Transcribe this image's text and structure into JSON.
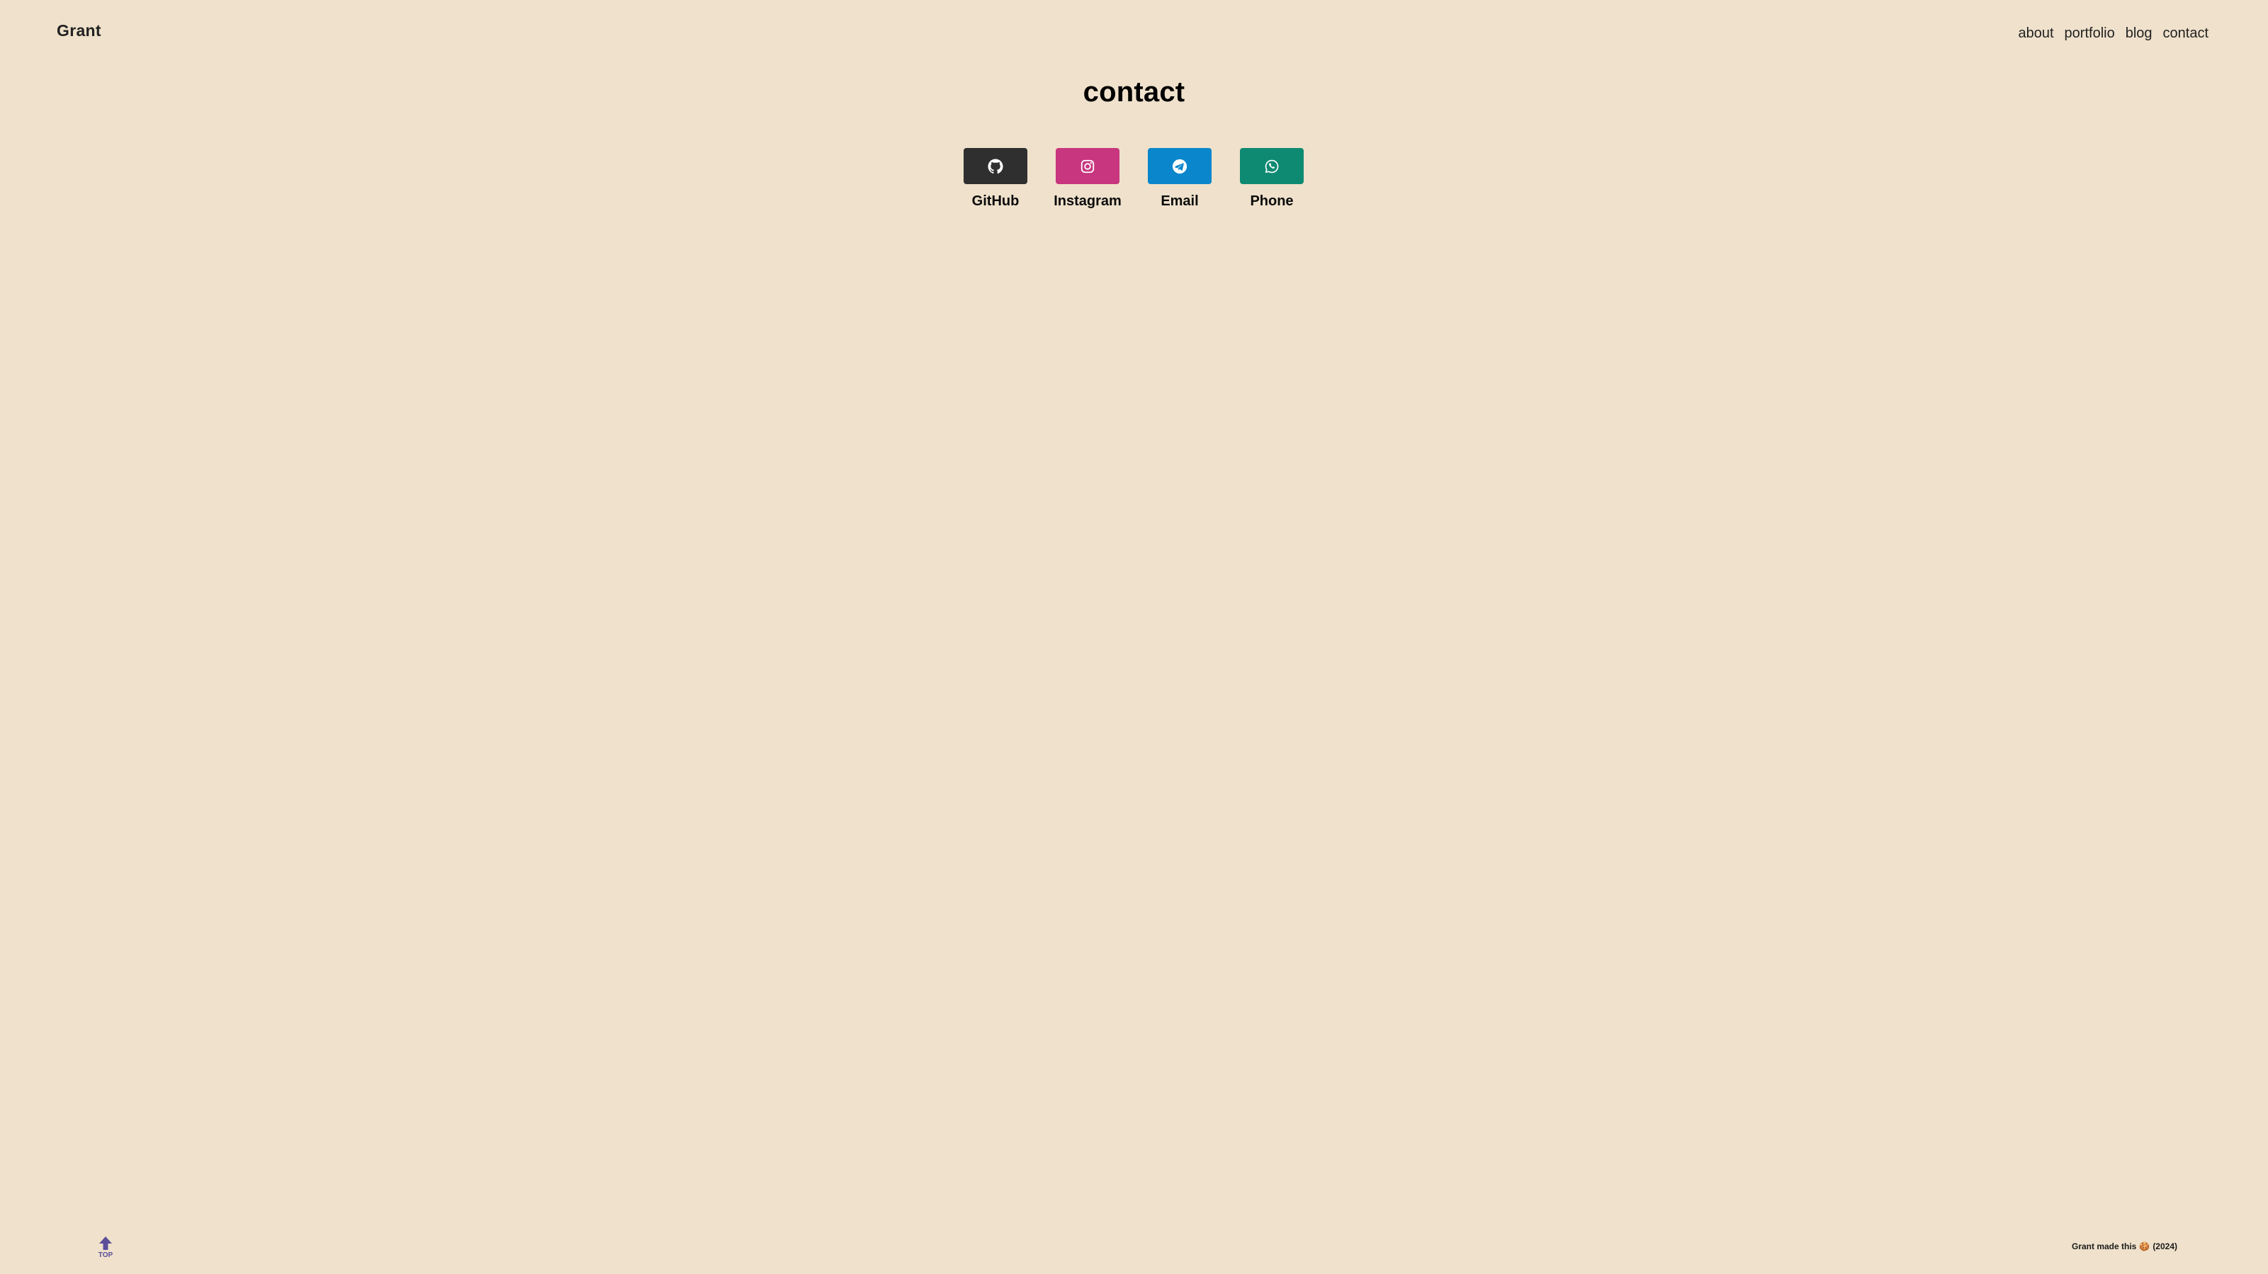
{
  "header": {
    "brand": "Grant",
    "nav": [
      "about",
      "portfolio",
      "blog",
      "contact"
    ]
  },
  "main": {
    "title": "contact",
    "contacts": [
      {
        "label": "GitHub",
        "icon": "github-icon",
        "color": "#2f2f2f"
      },
      {
        "label": "Instagram",
        "icon": "instagram-icon",
        "color": "#c8367f"
      },
      {
        "label": "Email",
        "icon": "telegram-icon",
        "color": "#0a86cc"
      },
      {
        "label": "Phone",
        "icon": "whatsapp-icon",
        "color": "#0f8a72"
      }
    ]
  },
  "footer": {
    "top_label": "TOP",
    "credit_prefix": "Grant made this",
    "credit_emoji": "🍪",
    "credit_year": "(2024)"
  },
  "colors": {
    "background": "#efe1cb",
    "top_button": "#5b4f9a"
  }
}
